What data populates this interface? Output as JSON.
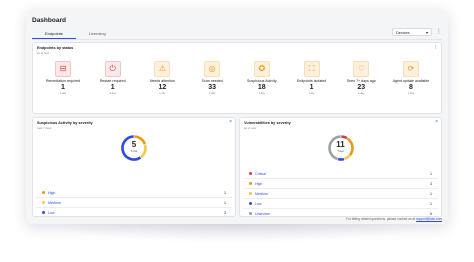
{
  "app": {
    "title": "Dashboard"
  },
  "tabs": [
    {
      "label": "Endpoints"
    },
    {
      "label": "Licensing"
    }
  ],
  "filter": {
    "value": "Devices",
    "caret": "▾",
    "menu_glyph": "⋮"
  },
  "endpoints_card": {
    "title": "Endpoints by status",
    "subtitle": "as of now",
    "menu_glyph": "⋮",
    "items": [
      {
        "label": "Remediation required",
        "count": "1",
        "meta": "1 day",
        "icon": "briefcase-icon",
        "glyph": "⊟",
        "bg": "#fde8e8",
        "color": "#d63b3b"
      },
      {
        "label": "Restart required",
        "count": "1",
        "meta": "1 day",
        "icon": "power-icon",
        "glyph": "⏻",
        "bg": "#fde8e8",
        "color": "#d63b3b"
      },
      {
        "label": "Needs attention",
        "count": "12",
        "meta": "1 day",
        "icon": "warning-icon",
        "glyph": "⚠",
        "bg": "#fdf1dd",
        "color": "#e69a1a"
      },
      {
        "label": "Scan needed",
        "count": "33",
        "meta": "1 day",
        "icon": "scan-icon",
        "glyph": "◎",
        "bg": "#fdf1dd",
        "color": "#e69a1a"
      },
      {
        "label": "Suspicious Activity",
        "count": "18",
        "meta": "1 day",
        "icon": "bug-icon",
        "glyph": "✪",
        "bg": "#fdf1dd",
        "color": "#e69a1a"
      },
      {
        "label": "Endpoints isolated",
        "count": "1",
        "meta": "1 day",
        "icon": "isolation-icon",
        "glyph": "⛶",
        "bg": "#fdf1dd",
        "color": "#e69a1a"
      },
      {
        "label": "Seen 7+ days ago",
        "count": "23",
        "meta": "1 day",
        "icon": "heart-monitor-icon",
        "glyph": "♡",
        "bg": "#fdf1dd",
        "color": "#e69a1a"
      },
      {
        "label": "Agent update available",
        "count": "8",
        "meta": "1 day",
        "icon": "update-icon",
        "glyph": "⟳",
        "bg": "#fdf1dd",
        "color": "#e69a1a"
      }
    ]
  },
  "suspicious_card": {
    "title": "Suspicious Activity by severity",
    "subtitle": "Last 7 days",
    "close_glyph": "×",
    "total": "5",
    "total_label": "Total",
    "chart_data": {
      "type": "pie",
      "categories": [
        "High",
        "Medium",
        "Low"
      ],
      "values": [
        1,
        1,
        3
      ],
      "colors": [
        "#e69a1a",
        "#f2c94c",
        "#2f4cdd"
      ]
    },
    "rows": [
      {
        "name": "High",
        "value": "1",
        "color": "#e69a1a"
      },
      {
        "name": "Medium",
        "value": "1",
        "color": "#f2c94c"
      },
      {
        "name": "Low",
        "value": "3",
        "color": "#2f4cdd"
      }
    ]
  },
  "vuln_card": {
    "title": "Vulnerabilities by severity",
    "subtitle": "as of now",
    "close_glyph": "×",
    "total": "11",
    "total_label": "Total",
    "chart_data": {
      "type": "pie",
      "categories": [
        "Critical",
        "High",
        "Medium",
        "Low",
        "Unknown"
      ],
      "values": [
        1,
        3,
        1,
        1,
        5
      ],
      "colors": [
        "#d63b3b",
        "#e69a1a",
        "#f2c94c",
        "#2f4cdd",
        "#9aa0a8"
      ]
    },
    "rows": [
      {
        "name": "Critical",
        "value": "1",
        "color": "#d63b3b"
      },
      {
        "name": "High",
        "value": "3",
        "color": "#e69a1a"
      },
      {
        "name": "Medium",
        "value": "1",
        "color": "#f2c94c"
      },
      {
        "name": "Low",
        "value": "1",
        "color": "#2f4cdd"
      },
      {
        "name": "Unknown",
        "value": "5",
        "color": "#9aa0a8"
      }
    ]
  },
  "footer": {
    "text": "For billing related questions, please contact us at",
    "link": "support@abc.com"
  }
}
